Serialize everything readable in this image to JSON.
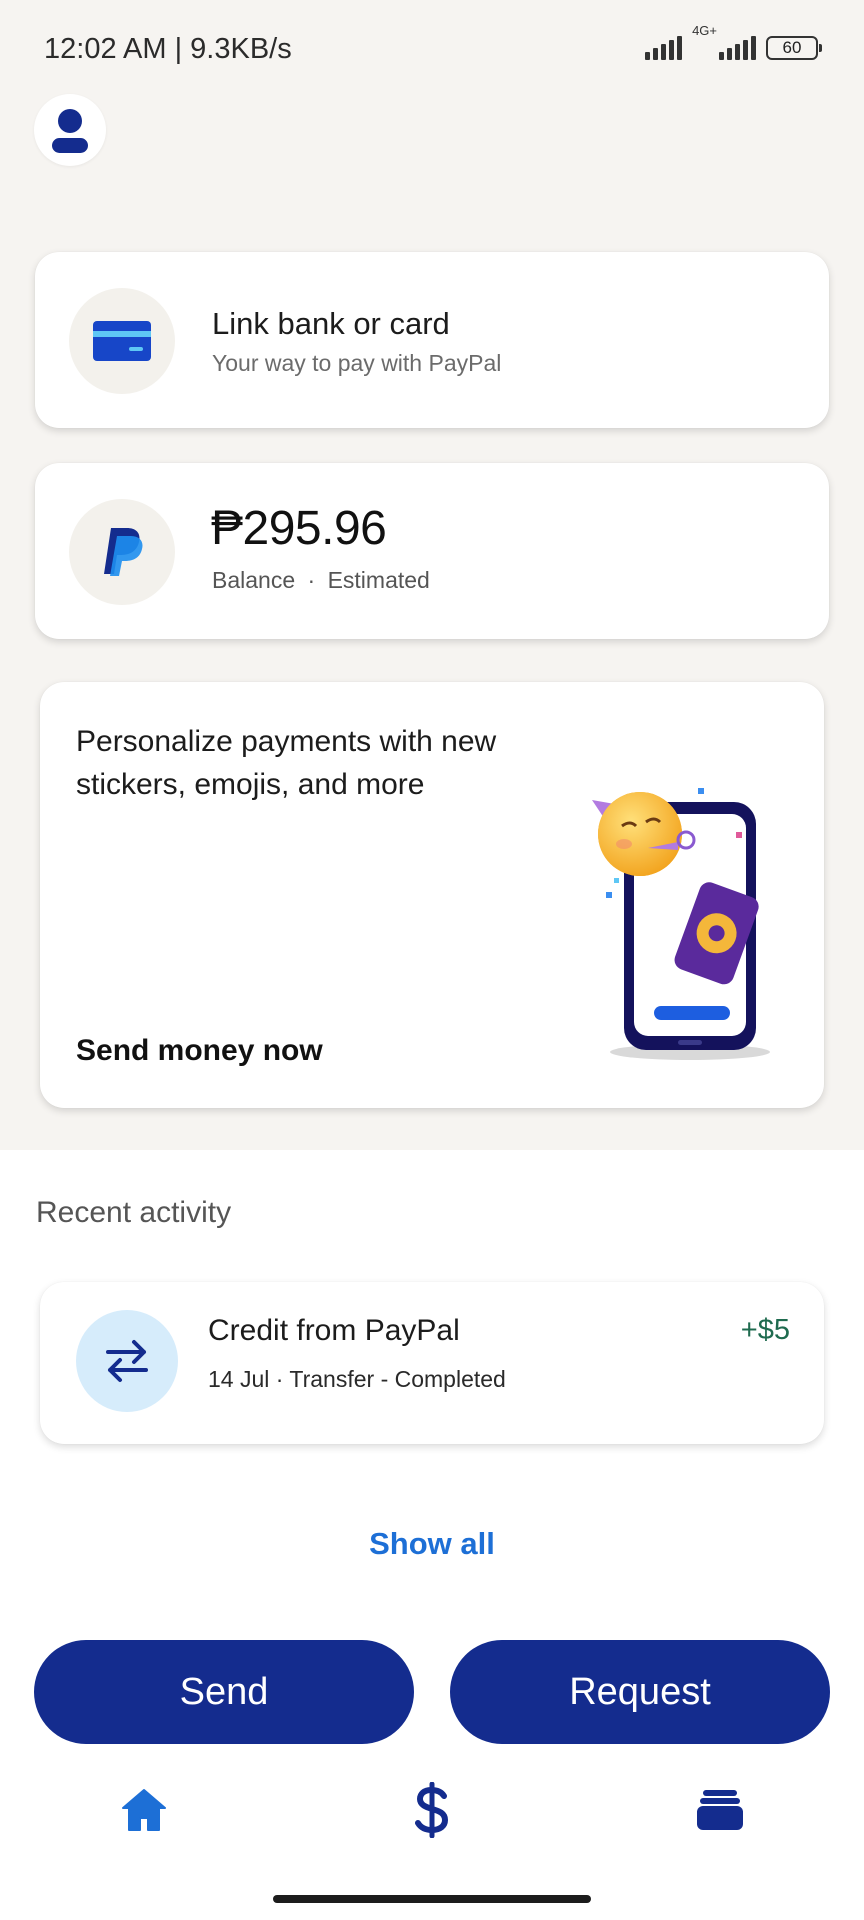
{
  "status_bar": {
    "time": "12:02 AM | 9.3KB/s",
    "network": "4G+",
    "battery": "60"
  },
  "profile": {
    "icon": "person-icon"
  },
  "link_card": {
    "title": "Link bank or card",
    "subtitle": "Your way to pay with PayPal",
    "icon": "credit-card-icon"
  },
  "balance_card": {
    "amount": "₱295.96",
    "label": "Balance",
    "separator": "·",
    "note": "Estimated",
    "icon": "paypal-logo-icon"
  },
  "promo": {
    "text": "Personalize payments with new stickers, emojis, and more",
    "link": "Send money now"
  },
  "recent": {
    "label": "Recent activity",
    "items": [
      {
        "title": "Credit from PayPal",
        "details": "14 Jul · Transfer - Completed",
        "amount": "+$5",
        "icon": "transfer-arrows-icon"
      }
    ],
    "show_all": "Show all"
  },
  "actions": {
    "send": "Send",
    "request": "Request"
  },
  "nav": {
    "home": "home-icon",
    "pay": "dollar-icon",
    "wallet": "wallet-icon"
  },
  "colors": {
    "brand_navy": "#142c8e",
    "link_blue": "#1d6fd6",
    "positive_green": "#1f6b4f",
    "top_background": "#f6f4f1"
  }
}
